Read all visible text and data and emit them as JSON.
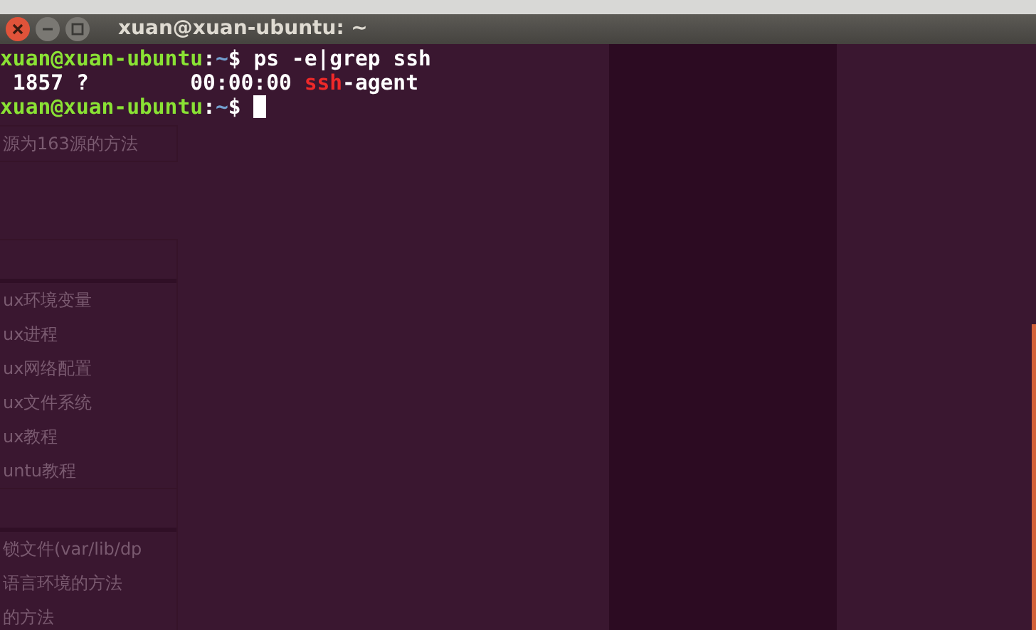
{
  "window": {
    "title": "xuan@xuan-ubuntu: ~",
    "buttons": [
      {
        "kind": "close"
      },
      {
        "kind": "minimize"
      },
      {
        "kind": "maximize"
      }
    ]
  },
  "terminal": {
    "lines": [
      {
        "segments": [
          {
            "text": "xuan@xuan-ubuntu",
            "color": "#8ae234"
          },
          {
            "text": ":",
            "color": "#ffffff"
          },
          {
            "text": "~",
            "color": "#729fcf"
          },
          {
            "text": "$ ps -e|grep ssh",
            "color": "#ffffff"
          }
        ]
      },
      {
        "segments": [
          {
            "text": " 1857 ?        00:00:00 ",
            "color": "#ffffff"
          },
          {
            "text": "ssh",
            "color": "#ef2929"
          },
          {
            "text": "-agent",
            "color": "#ffffff"
          }
        ]
      },
      {
        "segments": [
          {
            "text": "xuan@xuan-ubuntu",
            "color": "#8ae234"
          },
          {
            "text": ":",
            "color": "#ffffff"
          },
          {
            "text": "~",
            "color": "#729fcf"
          },
          {
            "text": "$ ",
            "color": "#ffffff"
          }
        ],
        "cursor": true
      }
    ]
  },
  "background_page": {
    "groups": [
      {
        "items": [
          "源为163源的方法"
        ]
      },
      {
        "items": [
          "ux环境变量",
          "ux进程",
          "ux网络配置",
          "ux文件系统",
          "ux教程",
          "untu教程"
        ]
      },
      {
        "items": [
          "锁文件(var/lib/dp",
          "语言环境的方法",
          "的方法"
        ]
      }
    ]
  }
}
